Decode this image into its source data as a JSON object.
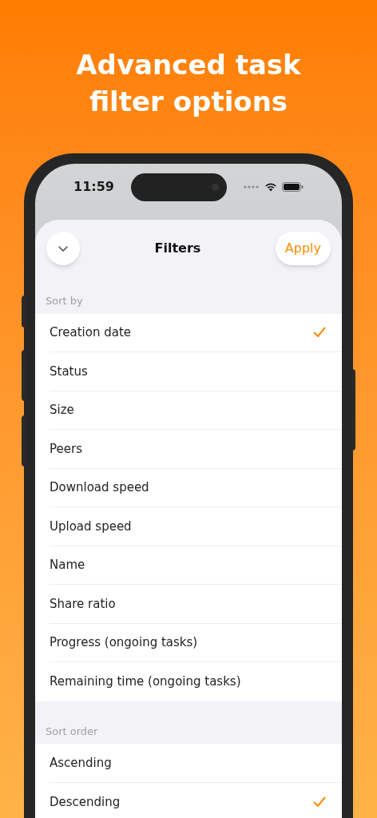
{
  "headline": "Advanced task\nfilter options",
  "status_bar": {
    "time": "11:59"
  },
  "sheet": {
    "title": "Filters",
    "apply_button": "Apply"
  },
  "sections": [
    {
      "header": "Sort by",
      "items": [
        {
          "label": "Creation date",
          "selected": true
        },
        {
          "label": "Status",
          "selected": false
        },
        {
          "label": "Size",
          "selected": false
        },
        {
          "label": "Peers",
          "selected": false
        },
        {
          "label": "Download speed",
          "selected": false
        },
        {
          "label": "Upload speed",
          "selected": false
        },
        {
          "label": "Name",
          "selected": false
        },
        {
          "label": "Share ratio",
          "selected": false
        },
        {
          "label": "Progress (ongoing tasks)",
          "selected": false
        },
        {
          "label": "Remaining time (ongoing tasks)",
          "selected": false
        }
      ]
    },
    {
      "header": "Sort order",
      "items": [
        {
          "label": "Ascending",
          "selected": false
        },
        {
          "label": "Descending",
          "selected": true
        }
      ]
    }
  ]
}
